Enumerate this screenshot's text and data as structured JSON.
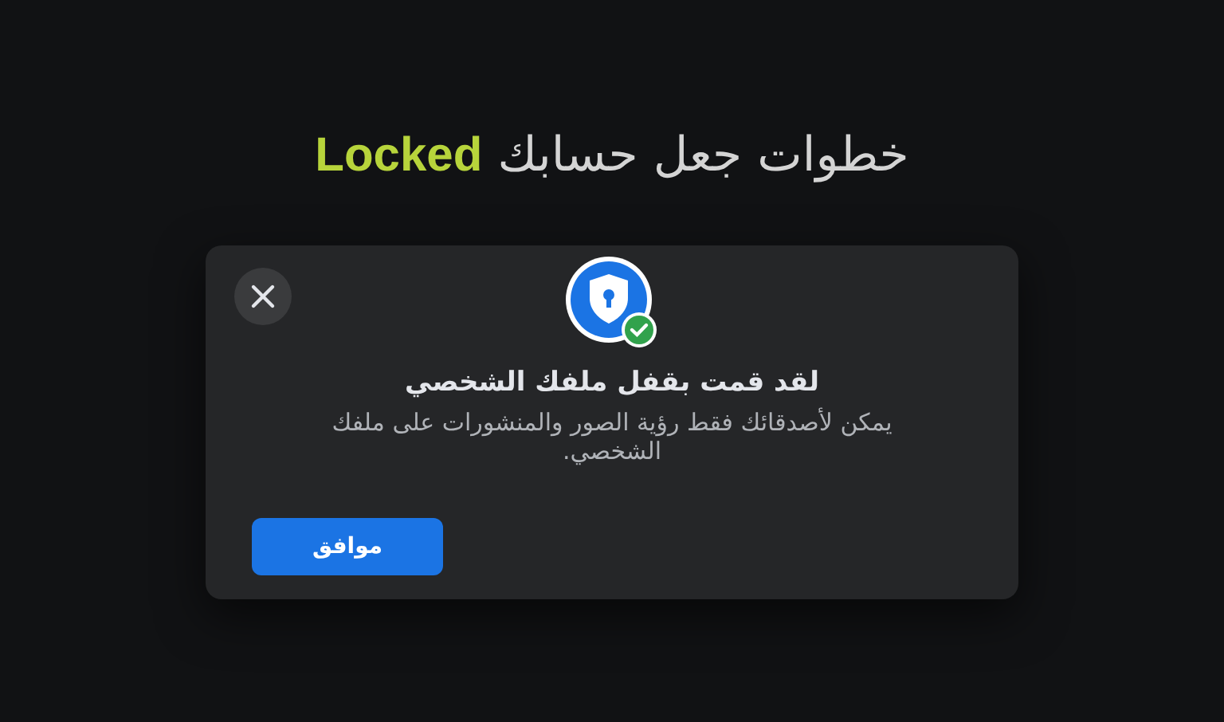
{
  "headline": "خطوات جعل حسابك **Locked**",
  "dialog": {
    "title": "لقد قمت بقفل ملفك الشخصي",
    "message": "يمكن لأصدقائك فقط رؤية الصور والمنشورات على ملفك الشخصي.",
    "button": "موافق"
  }
}
